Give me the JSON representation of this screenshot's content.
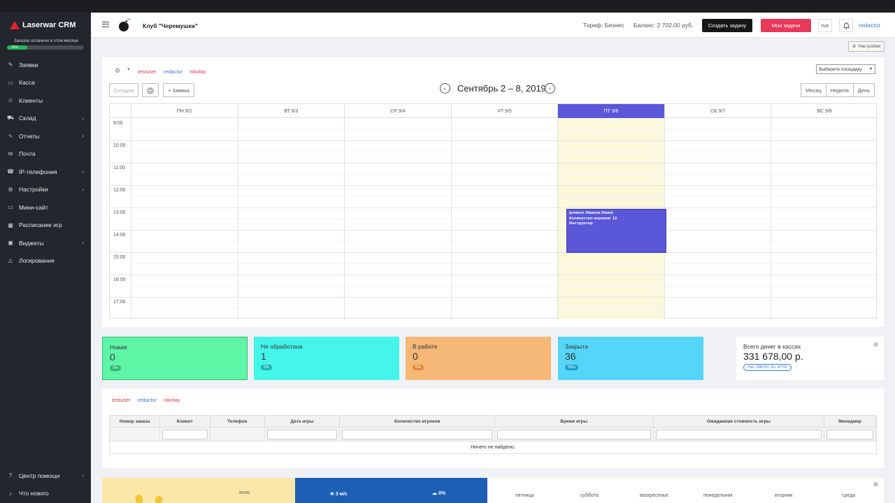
{
  "sidebar": {
    "logo": "Laserwar CRM",
    "paid_text": "Заказов оплачено в этом месяце",
    "paid_progress": "26%",
    "items": [
      {
        "label": "Заявки",
        "icon": "edit-icon",
        "chevron": false
      },
      {
        "label": "Касса",
        "icon": "cash-icon",
        "chevron": false
      },
      {
        "label": "Клиенты",
        "icon": "users-icon",
        "chevron": false
      },
      {
        "label": "Склад",
        "icon": "cart-icon",
        "chevron": true
      },
      {
        "label": "Отчеты",
        "icon": "chart-icon",
        "chevron": true
      },
      {
        "label": "Почта",
        "icon": "mail-icon",
        "chevron": false
      },
      {
        "label": "IP-телефония",
        "icon": "phone-icon",
        "chevron": true
      },
      {
        "label": "Настройки",
        "icon": "gear-icon",
        "chevron": true
      },
      {
        "label": "Мини-сайт",
        "icon": "monitor-icon",
        "chevron": false
      },
      {
        "label": "Расписание игр",
        "icon": "calendar-icon",
        "chevron": false
      },
      {
        "label": "Виджеты",
        "icon": "widget-icon",
        "chevron": true
      },
      {
        "label": "Логирование",
        "icon": "warning-icon",
        "chevron": false
      }
    ],
    "bottom_items": [
      {
        "label": "Центр помощи",
        "icon": "help-icon",
        "chevron": true
      },
      {
        "label": "Что нового",
        "icon": "bell-icon",
        "chevron": false
      }
    ]
  },
  "topbar": {
    "club": "Клуб \"Черемушки\"",
    "tariff": "Тариф: Бизнес",
    "balance": "Баланс: 2 702,00 руб.",
    "create_task": "Создать задачу",
    "my_tasks": "Мои задачи",
    "lang": "rus",
    "user": "redactor"
  },
  "settings_button": "Настройки",
  "calendar": {
    "users": [
      {
        "name": "testuser",
        "color": "red"
      },
      {
        "name": "redactor",
        "color": "blue"
      },
      {
        "name": "nikolay",
        "color": "red"
      }
    ],
    "venue_placeholder": "Выберите площадку",
    "today_btn": "Сегодня",
    "new_request_btn": "+ Заявка",
    "title": "Сентябрь 2 – 8, 2019",
    "views": [
      "Месяц",
      "Неделя",
      "День"
    ],
    "days": [
      "ПН 9/2",
      "ВТ 9/3",
      "СР 9/4",
      "ЧТ 9/5",
      "ПТ 9/6",
      "СБ 9/7",
      "ВС 9/8"
    ],
    "today_index": 4,
    "times": [
      "9:00",
      "10:00",
      "11:00",
      "12:00",
      "13:00",
      "14:00",
      "15:00",
      "16:00",
      "17:00"
    ],
    "event": {
      "line1": "(клиент Иванов Иван)",
      "line2": "Количество игроков: 12",
      "line3": "Инструктор:"
    }
  },
  "stats": [
    {
      "label": "Новая",
      "value": "0",
      "pct": "0%",
      "bg": "#5ef5a7",
      "pill": "#2fb872"
    },
    {
      "label": "Не обработана",
      "value": "1",
      "pct": "2%",
      "bg": "#44f5ea",
      "pill": "#1fb5ad"
    },
    {
      "label": "В работе",
      "value": "0",
      "pct": "0%",
      "bg": "#f5b877",
      "pill": "#e08a3c"
    },
    {
      "label": "Закрыта",
      "value": "36",
      "pct": "58%",
      "bg": "#55d5f7",
      "pill": "#1a9fc9"
    }
  ],
  "money": {
    "label": "Всего денег в кассах",
    "value": "331 678,00 р.",
    "detail": "Нал: 288978 | б/н: 42700"
  },
  "orders": {
    "users": [
      {
        "name": "testuser",
        "color": "red"
      },
      {
        "name": "redactor",
        "color": "blue"
      },
      {
        "name": "nikolay",
        "color": "red"
      }
    ],
    "columns": [
      "Номер заказа",
      "Клиент",
      "Телефон",
      "Дата игры",
      "Количество игроков",
      "Время игры",
      "Ожидаемая стоимость игры",
      "Менеджер"
    ],
    "empty": "Ничего не найдено."
  },
  "weather": {
    "condition": "ясно",
    "wind": "3 м/с",
    "rain": "0%",
    "days": [
      "пятница",
      "суббота",
      "воскресенье",
      "понедельник",
      "вторник",
      "среда"
    ]
  }
}
